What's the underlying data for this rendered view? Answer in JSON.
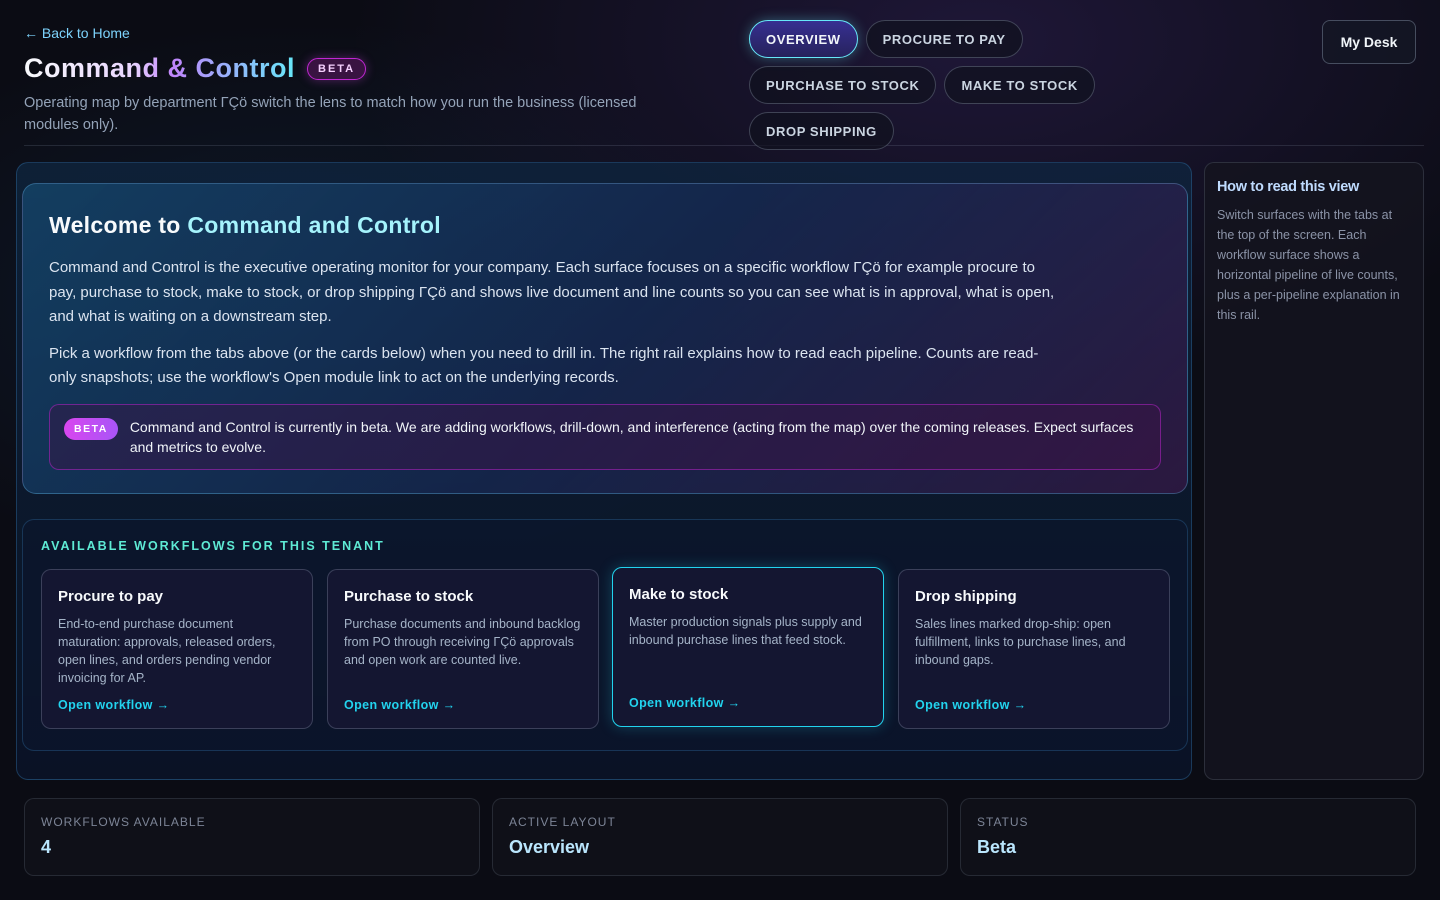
{
  "header": {
    "back_link": "← Back to Home",
    "title": "Command & Control",
    "beta_badge": "BETA",
    "subtitle": "Operating map by department ΓÇö switch the lens to match how you run the business (licensed modules only).",
    "my_desk": "My Desk",
    "tabs": [
      {
        "label": "OVERVIEW",
        "active": true
      },
      {
        "label": "PROCURE TO PAY",
        "active": false
      },
      {
        "label": "PURCHASE TO STOCK",
        "active": false
      },
      {
        "label": "MAKE TO STOCK",
        "active": false
      },
      {
        "label": "DROP SHIPPING",
        "active": false
      }
    ]
  },
  "welcome": {
    "title_prefix": "Welcome to ",
    "title_accent": "Command and Control",
    "paragraph1": "Command and Control is the executive operating monitor for your company. Each surface focuses on a specific workflow ΓÇö for example procure to pay, purchase to stock, make to stock, or drop shipping ΓÇö and shows live document and line counts so you can see what is in approval, what is open, and what is waiting on a downstream step.",
    "paragraph2": "Pick a workflow from the tabs above (or the cards below) when you need to drill in. The right rail explains how to read each pipeline. Counts are read-only snapshots; use the workflow's Open module link to act on the underlying records.",
    "beta_tag": "BETA",
    "beta_note": "Command and Control is currently in beta. We are adding workflows, drill-down, and interference (acting from the map) over the coming releases. Expect surfaces and metrics to evolve."
  },
  "workflows": {
    "heading": "AVAILABLE WORKFLOWS FOR THIS TENANT",
    "cards": [
      {
        "title": "Procure to pay",
        "description": "End-to-end purchase document maturation: approvals, released orders, open lines, and orders pending vendor invoicing for AP.",
        "link": "Open workflow →"
      },
      {
        "title": "Purchase to stock",
        "description": "Purchase documents and inbound backlog from PO through receiving ΓÇö approvals and open work are counted live.",
        "link": "Open workflow →"
      },
      {
        "title": "Make to stock",
        "description": "Master production signals plus supply and inbound purchase lines that feed stock.",
        "link": "Open workflow →"
      },
      {
        "title": "Drop shipping",
        "description": "Sales lines marked drop-ship: open fulfillment, links to purchase lines, and inbound gaps.",
        "link": "Open workflow →"
      }
    ]
  },
  "rail": {
    "title": "How to read this view",
    "text": "Switch surfaces with the tabs at the top of the screen. Each workflow surface shows a horizontal pipeline of live counts, plus a per-pipeline explanation in this rail."
  },
  "stats": [
    {
      "label": "WORKFLOWS AVAILABLE",
      "value": "4"
    },
    {
      "label": "ACTIVE LAYOUT",
      "value": "Overview"
    },
    {
      "label": "STATUS",
      "value": "Beta"
    }
  ],
  "colors": {
    "accent_cyan": "#22d3ee",
    "accent_teal": "#5eead4",
    "beta_magenta": "#d946ef",
    "background": "#0b0c14"
  }
}
